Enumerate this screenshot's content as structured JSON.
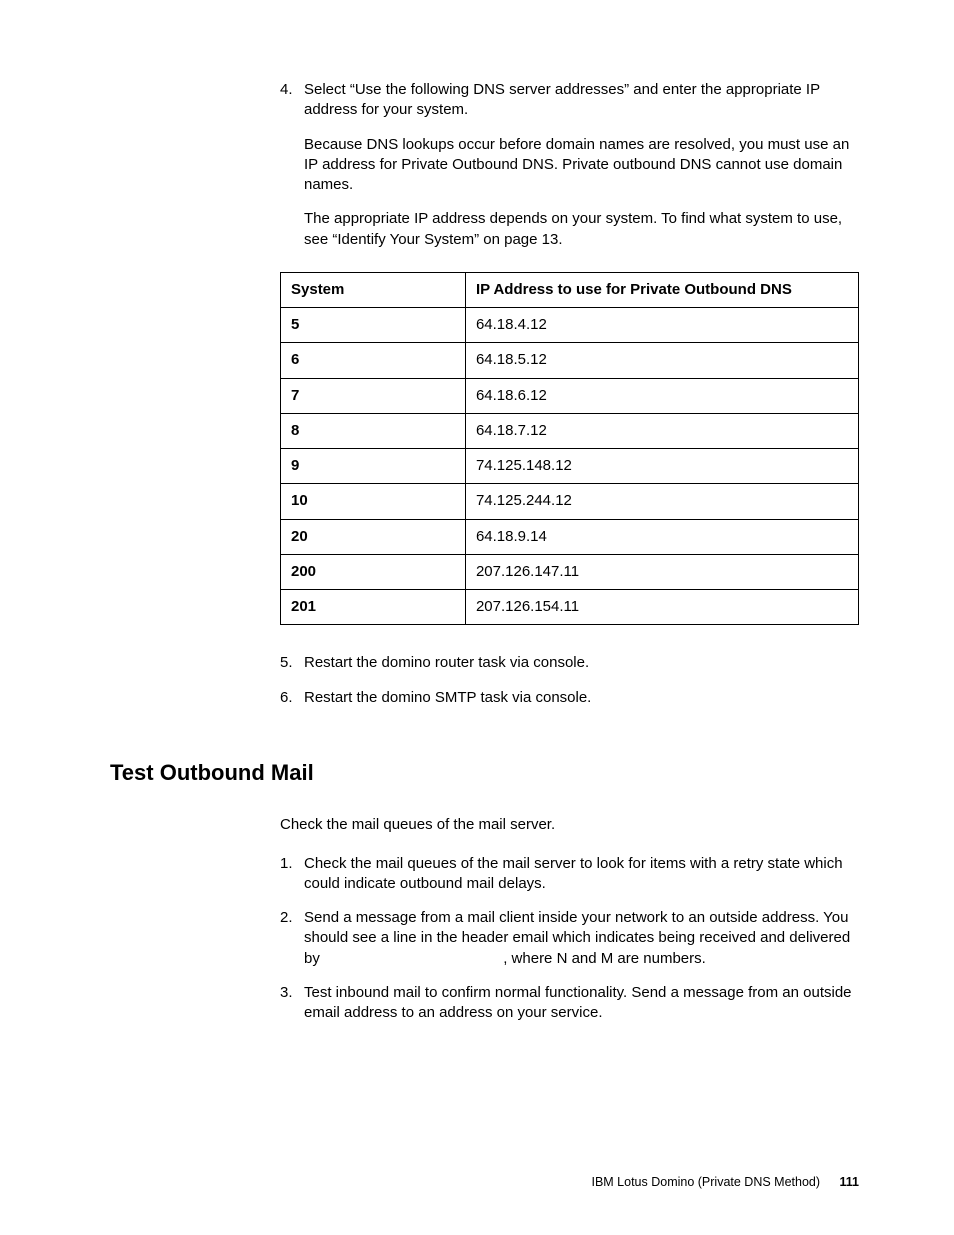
{
  "step4": {
    "num": "4.",
    "p1": "Select “Use the following DNS server addresses” and enter the appropriate IP address for your system.",
    "p2": "Because DNS lookups occur before domain names are resolved, you must use an IP address for Private Outbound DNS. Private outbound DNS cannot use domain names.",
    "p3": "The appropriate IP address depends on your system. To find what system to use, see “Identify Your System” on page 13."
  },
  "table": {
    "h1": "System",
    "h2": "IP Address to use for Private Outbound DNS",
    "rows": [
      {
        "s": "5",
        "ip": "64.18.4.12"
      },
      {
        "s": "6",
        "ip": "64.18.5.12"
      },
      {
        "s": "7",
        "ip": "64.18.6.12"
      },
      {
        "s": "8",
        "ip": "64.18.7.12"
      },
      {
        "s": "9",
        "ip": "74.125.148.12"
      },
      {
        "s": "10",
        "ip": "74.125.244.12"
      },
      {
        "s": "20",
        "ip": "64.18.9.14"
      },
      {
        "s": "200",
        "ip": "207.126.147.11"
      },
      {
        "s": "201",
        "ip": "207.126.154.11"
      }
    ]
  },
  "step5": {
    "num": "5.",
    "text": "Restart the domino router task via console."
  },
  "step6": {
    "num": "6.",
    "text": "Restart the domino SMTP task via console."
  },
  "section2": {
    "title": "Test Outbound Mail",
    "intro": "Check the mail queues of the mail server.",
    "i1": {
      "num": "1.",
      "text": "Check the mail queues of the mail server to look for items with a retry state which could indicate outbound mail delays."
    },
    "i2": {
      "num": "2.",
      "text": "Send a message from a mail client inside your network to an outside address. You should see a line in the header email which indicates being received and delivered by                                            , where N and M are numbers."
    },
    "i3": {
      "num": "3.",
      "text": "Test inbound mail to confirm normal functionality. Send a message from an outside email address to an address on your service."
    }
  },
  "footer": {
    "title": "IBM Lotus Domino (Private DNS Method)",
    "page": "111"
  }
}
